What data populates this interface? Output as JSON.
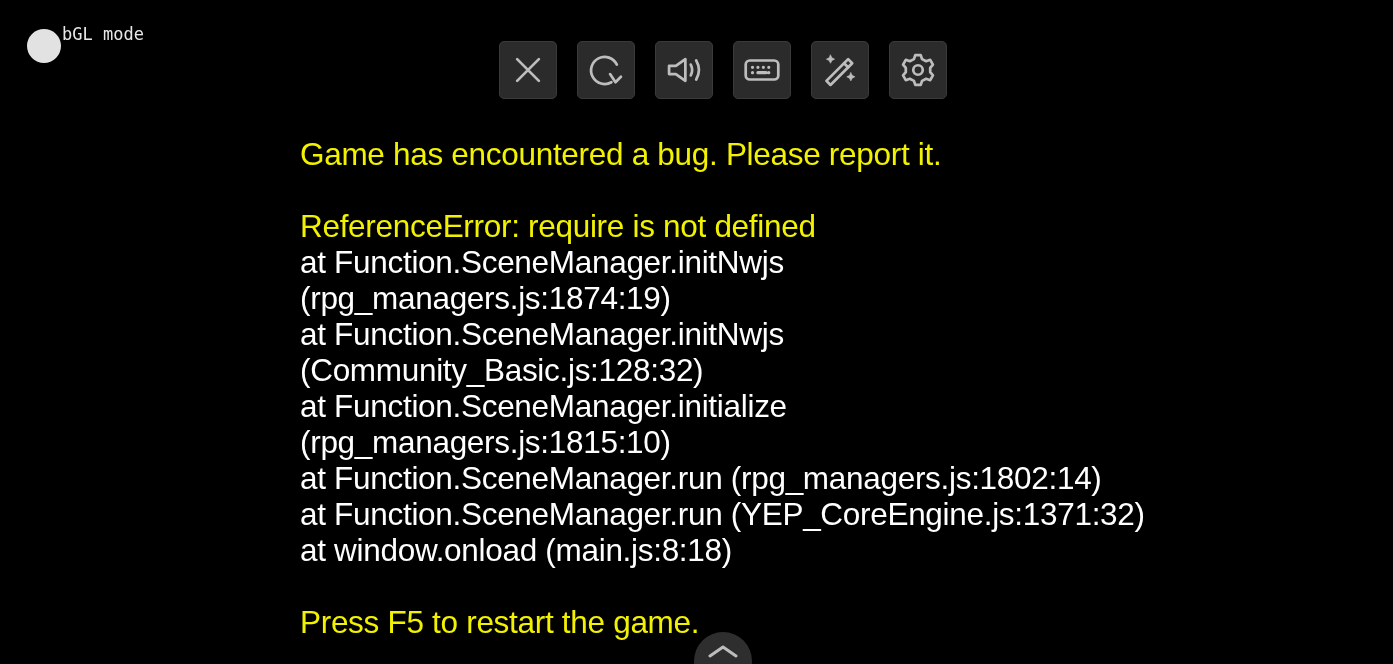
{
  "mode_label": "bGL mode",
  "toolbar": [
    {
      "kind": "close"
    },
    {
      "kind": "reload"
    },
    {
      "kind": "sound"
    },
    {
      "kind": "keyboard"
    },
    {
      "kind": "magic"
    },
    {
      "kind": "settings"
    }
  ],
  "error": {
    "headline": "Game has encountered a bug. Please report it.",
    "message": "ReferenceError: require is not defined",
    "stack": [
      "at Function.SceneManager.initNwjs (rpg_managers.js:1874:19)",
      "at Function.SceneManager.initNwjs (Community_Basic.js:128:32)",
      "at Function.SceneManager.initialize (rpg_managers.js:1815:10)",
      "at Function.SceneManager.run (rpg_managers.js:1802:14)",
      "at Function.SceneManager.run (YEP_CoreEngine.js:1371:32)",
      "at window.onload (main.js:8:18)"
    ],
    "footer": "Press F5 to restart the game."
  }
}
